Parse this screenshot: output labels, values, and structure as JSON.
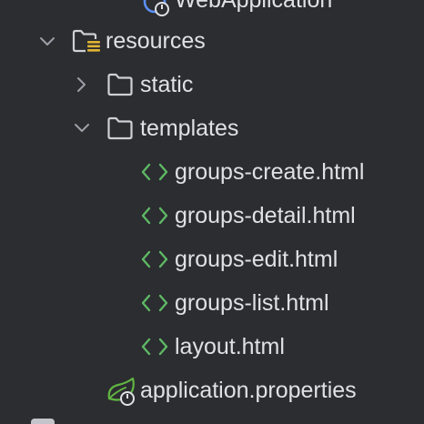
{
  "theme": {
    "background": "#2b2d30",
    "text": "#dfe1e5",
    "arrow": "#9da0a8",
    "folder": "#ced0d6",
    "html_tag": "#5fb865",
    "spring_green": "#62b543",
    "resources_badge": "#e0b533",
    "app_icon_blue": "#5b8ef5"
  },
  "tree": {
    "partial_top_item": {
      "label": "WebApplication",
      "icon": "spring-boot-class-icon"
    },
    "resources": {
      "label": "resources",
      "icon": "resources-folder-icon",
      "expanded": true
    },
    "static": {
      "label": "static",
      "icon": "folder-icon",
      "expanded": false
    },
    "templates": {
      "label": "templates",
      "icon": "folder-icon",
      "expanded": true
    },
    "files": [
      {
        "label": "groups-create.html",
        "icon": "html-file-icon"
      },
      {
        "label": "groups-detail.html",
        "icon": "html-file-icon"
      },
      {
        "label": "groups-edit.html",
        "icon": "html-file-icon"
      },
      {
        "label": "groups-list.html",
        "icon": "html-file-icon"
      },
      {
        "label": "layout.html",
        "icon": "html-file-icon"
      }
    ],
    "application_properties": {
      "label": "application.properties",
      "icon": "spring-properties-icon"
    }
  }
}
